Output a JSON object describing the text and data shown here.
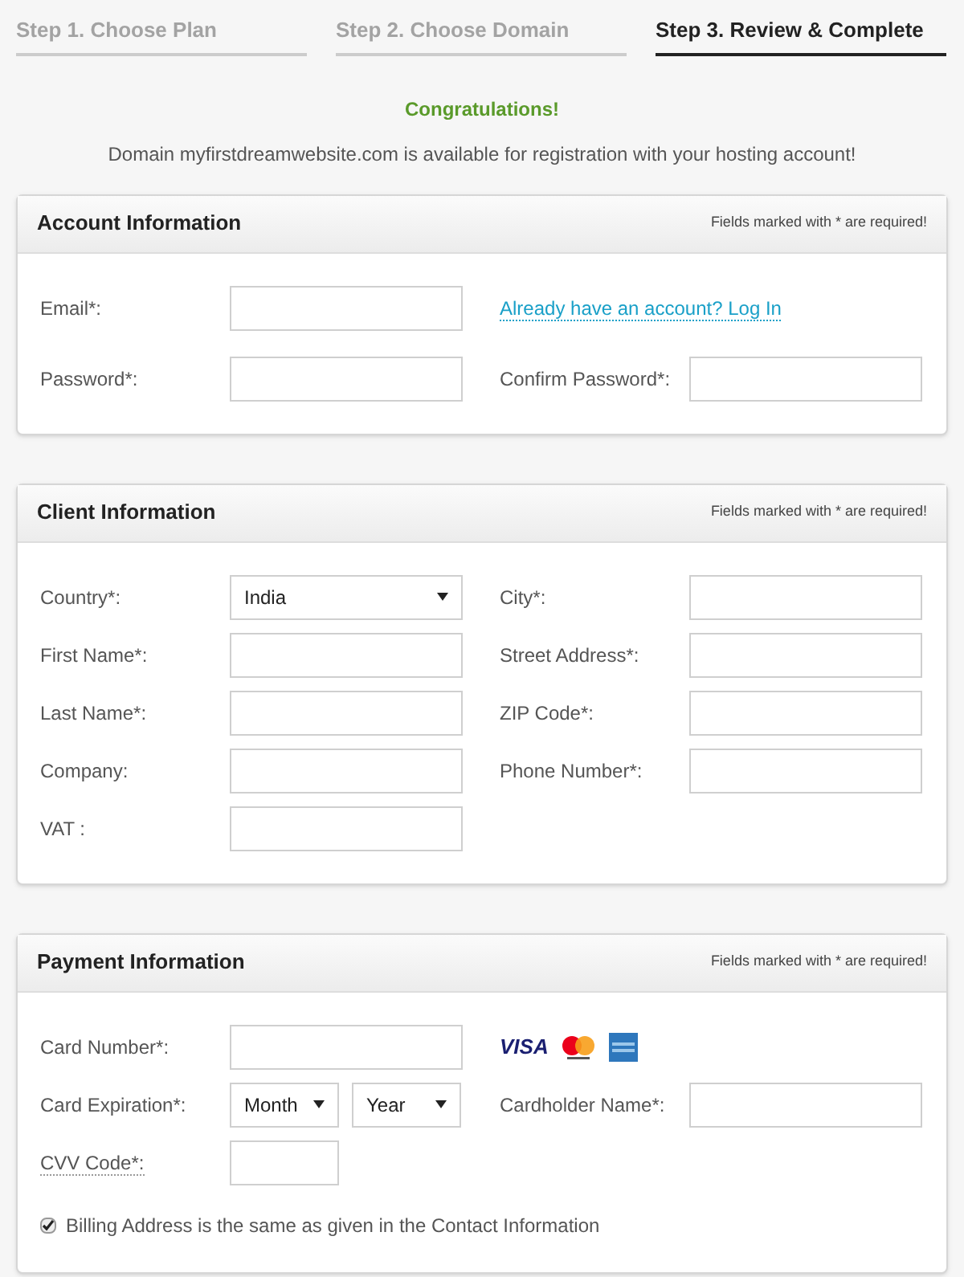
{
  "steps": [
    {
      "label": "Step 1. Choose Plan",
      "selected": false
    },
    {
      "label": "Step 2. Choose Domain",
      "selected": false
    },
    {
      "label": "Step 3. Review & Complete",
      "selected": true
    }
  ],
  "congrats": "Congratulations!",
  "message": "Domain myfirstdreamwebsite.com is available for registration with your hosting account!",
  "sections": [
    {
      "title": "Account Information",
      "note": "Fields marked with * are required!",
      "rows": [
        [
          {
            "kind": "input",
            "label": "Email*:"
          },
          {
            "kind": "link",
            "text": "Already have an account? Log In"
          }
        ],
        [
          {
            "kind": "input",
            "label": "Password*:"
          },
          {
            "kind": "input",
            "label": "Confirm Password*:"
          }
        ]
      ]
    },
    {
      "title": "Client Information",
      "note": "Fields marked with * are required!",
      "rows": [
        [
          {
            "kind": "select",
            "label": "Country*:",
            "value": "India"
          },
          {
            "kind": "input",
            "label": "City*:"
          }
        ],
        [
          {
            "kind": "input",
            "label": "First Name*:"
          },
          {
            "kind": "input",
            "label": "Street Address*:"
          }
        ],
        [
          {
            "kind": "input",
            "label": "Last Name*:"
          },
          {
            "kind": "input",
            "label": "ZIP Code*:"
          }
        ],
        [
          {
            "kind": "input",
            "label": "Company:"
          },
          {
            "kind": "input",
            "label": "Phone Number*:"
          }
        ],
        [
          {
            "kind": "input",
            "label": "VAT :"
          }
        ]
      ]
    },
    {
      "title": "Payment Information",
      "note": "Fields marked with * are required!",
      "rows": [
        [
          {
            "kind": "input",
            "label": "Card Number*:"
          },
          {
            "kind": "card-logos",
            "text": "VISA"
          }
        ],
        [
          {
            "kind": "date-selects",
            "label": "Card Expiration*:",
            "values": [
              "Month",
              "Year"
            ]
          },
          {
            "kind": "input",
            "label": "Cardholder Name*:"
          }
        ],
        [
          {
            "kind": "short-input",
            "label": "CVV Code*:"
          }
        ]
      ],
      "checkbox": {
        "label": "Billing Address is the same as given in the Contact Information",
        "checked": true
      }
    }
  ]
}
